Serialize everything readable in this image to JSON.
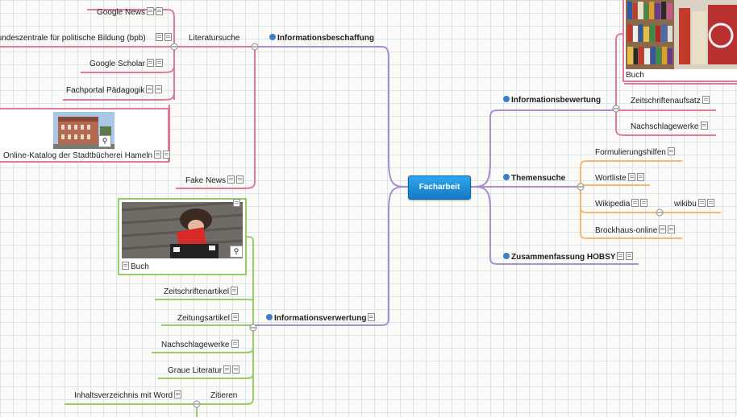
{
  "center": {
    "label": "Facharbeit"
  },
  "branches": {
    "beschaffung": {
      "label": "Informationsbeschaffung",
      "literatursuche": {
        "label": "Literatursuche",
        "items": [
          "Google News",
          "Bundeszentrale für politische Bildung (bpb)",
          "Google Scholar",
          "Fachportal Pädagogik"
        ],
        "image_caption": "Online-Katalog der Stadtbücherei Hameln"
      },
      "fake_news": "Fake News"
    },
    "verwertung": {
      "label": "Informationsverwertung",
      "image_caption": "Buch",
      "items": [
        "Zeitschriftenartikel",
        "Zeitungsartikel",
        "Nachschlagewerke",
        "Graue Literatur"
      ],
      "zitieren": {
        "label": "Zitieren",
        "items": [
          "Inhaltsverzeichnis mit Word"
        ]
      }
    },
    "bewertung": {
      "label": "Informationsbewertung",
      "image_caption": "Buch",
      "items": [
        "Zeitschriftenaufsatz",
        "Nachschlagewerke"
      ]
    },
    "themensuche": {
      "label": "Themensuche",
      "items": [
        "Formulierungshilfen",
        "Wortliste",
        "Wikipedia",
        "Brockhaus-online"
      ],
      "wikipedia_child": "wikibu"
    },
    "zusammenfassung": {
      "label": "Zusammenfassung HOBSY"
    }
  },
  "colors": {
    "pink": "#e07a9a",
    "purple": "#a58fcf",
    "green": "#9acb6a",
    "orange": "#f3b874",
    "center": "#1f8fdc",
    "bullet": "#3f7fc6"
  },
  "icons": [
    "note-icon",
    "zoom-icon",
    "bullet-icon",
    "collapse-icon"
  ]
}
